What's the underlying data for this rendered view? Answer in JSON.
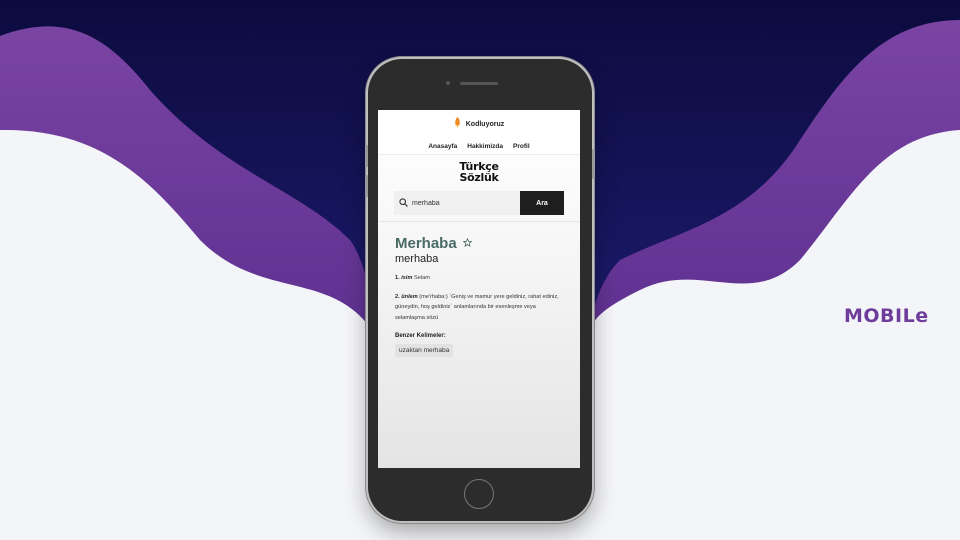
{
  "page": {
    "side_label": "MOBILe",
    "colors": {
      "navy": "#151257",
      "purple": "#74409c",
      "light": "#f4f5f8",
      "accent_word": "#4a6b64"
    }
  },
  "app": {
    "brand_name": "Kodluyoruz",
    "brand_icon": "rocket-icon",
    "nav": [
      "Anasayfa",
      "Hakkimizda",
      "Profil"
    ],
    "logo_line1": "Türkçe",
    "logo_line2": "Sözlük",
    "search": {
      "value": "merhaba",
      "button_label": "Ara",
      "icon": "search-icon"
    },
    "result": {
      "word": "Merhaba",
      "favorite_icon": "star-icon",
      "subtitle": "merhaba",
      "definitions": [
        {
          "number": "1.",
          "type": "isim",
          "text": "Selam"
        },
        {
          "number": "2.",
          "type": "ünlem",
          "text": "(me'rhaba:) `Geniş ve mamur yere geldiniz, rahat ediniz, güneydin, hoş geldiniz` anlamlarında bir esenleşme veya selamlaşma sözü"
        }
      ],
      "similar_heading": "Benzer Kelimeler:",
      "similar_words": [
        "uzaktan merhaba"
      ]
    }
  }
}
